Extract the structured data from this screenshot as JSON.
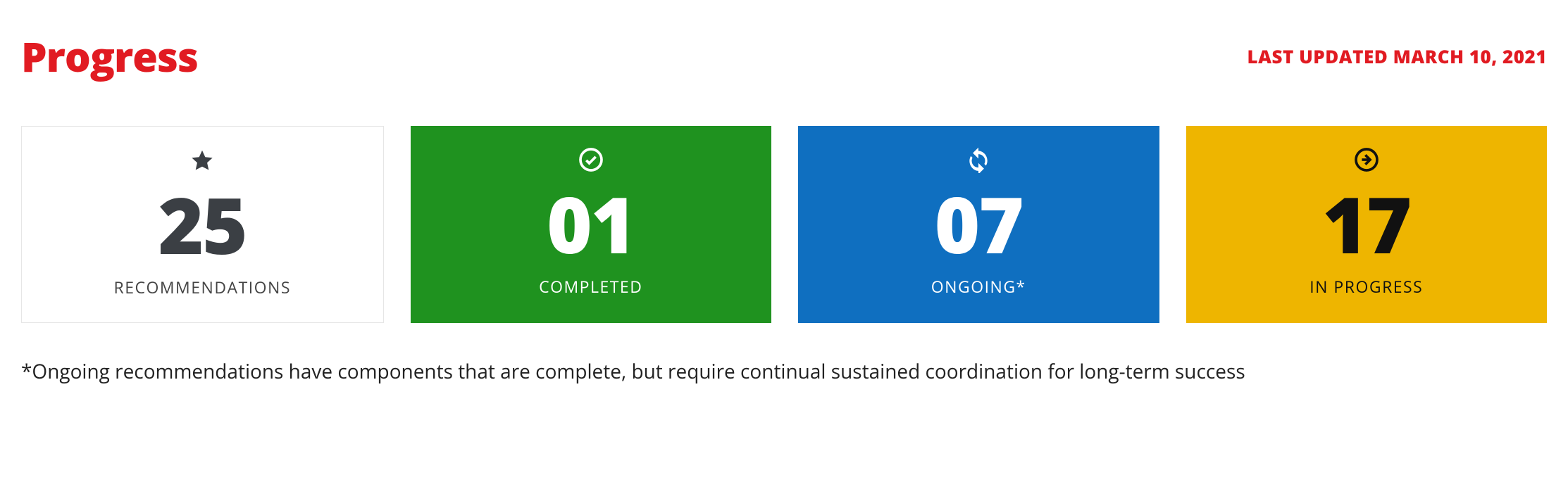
{
  "header": {
    "title": "Progress",
    "last_updated": "LAST UPDATED MARCH 10, 2021"
  },
  "cards": {
    "recommendations": {
      "number": "25",
      "label": "RECOMMENDATIONS"
    },
    "completed": {
      "number": "01",
      "label": "COMPLETED"
    },
    "ongoing": {
      "number": "07",
      "label": "ONGOING*"
    },
    "in_progress": {
      "number": "17",
      "label": "IN PROGRESS"
    }
  },
  "footnote": "*Ongoing recommendations have components that are complete, but require continual sustained coordination for long-term success",
  "colors": {
    "accent_red": "#e11b22",
    "green": "#1f921f",
    "blue": "#0f6fc0",
    "yellow": "#eeb500",
    "dark_text": "#3b3f44"
  },
  "chart_data": {
    "type": "table",
    "title": "Progress",
    "categories": [
      "RECOMMENDATIONS",
      "COMPLETED",
      "ONGOING*",
      "IN PROGRESS"
    ],
    "values": [
      25,
      1,
      7,
      17
    ],
    "note": "*Ongoing recommendations have components that are complete, but require continual sustained coordination for long-term success",
    "last_updated": "MARCH 10, 2021"
  }
}
